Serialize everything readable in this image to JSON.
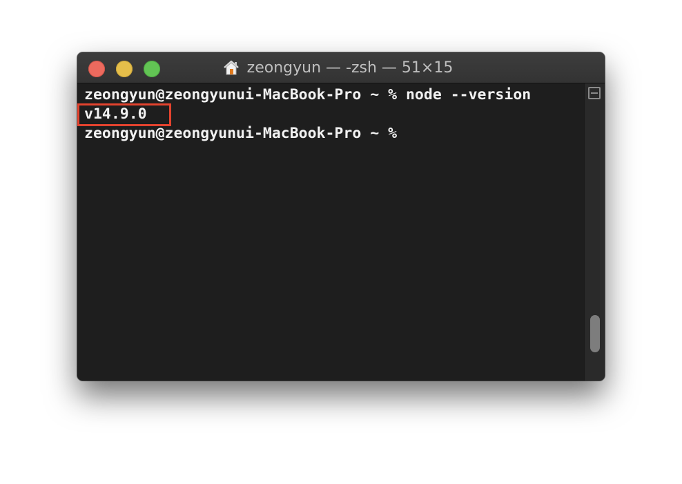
{
  "window": {
    "title": "zeongyun — -zsh — 51×15",
    "title_icon": "home-icon"
  },
  "terminal": {
    "lines": [
      "zeongyun@zeongyunui-MacBook-Pro ~ % node --version",
      "v14.9.0",
      "zeongyun@zeongyunui-MacBook-Pro ~ %"
    ],
    "highlighted_output": "v14.9.0"
  },
  "colors": {
    "background": "#1e1e1e",
    "text": "#f2f2f2",
    "highlight_border": "#e4432e",
    "close": "#ed6a5e",
    "minimize": "#e5be4a",
    "zoom": "#62c454"
  }
}
